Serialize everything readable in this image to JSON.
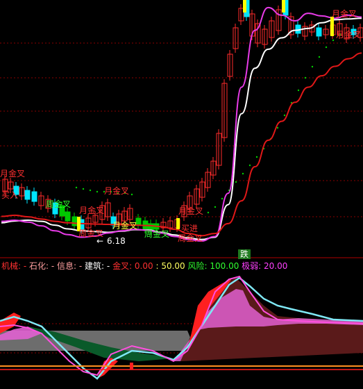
{
  "colors": {
    "bg": "#000000",
    "up": "#ff2b2b",
    "down": "#00e5ff",
    "ma_white": "#ffffff",
    "ma_magenta": "#e83be8",
    "ma_red": "#e01818",
    "dots": "#00d000",
    "signal_yellow": "#ffff00",
    "green_box": "#00c800",
    "label_red": "#ff3030",
    "label_yellow": "#ffff40",
    "label_green": "#30ff30",
    "grid": "#8b0000",
    "osc_red": "#ff2020",
    "osc_cyan": "#7fe8f5",
    "osc_magenta": "#ff4fe0",
    "osc_pink": "#e060d0",
    "osc_gray": "#808080",
    "osc_darkgreen": "#0a5a2a",
    "osc_brown": "#5a1a1a",
    "osc_orange": "#ff9020"
  },
  "main_labels": [
    {
      "text": "月金叉",
      "color": "label_red"
    },
    {
      "text": "买入",
      "color": "label_red"
    },
    {
      "text": "月金叉",
      "color": "label_red"
    },
    {
      "text": "周金叉",
      "color": "label_green"
    },
    {
      "text": "月金叉",
      "color": "label_red"
    },
    {
      "text": "月金叉",
      "color": "label_yellow"
    },
    {
      "text": "周金叉",
      "color": "label_green"
    },
    {
      "text": "周金叉",
      "color": "label_red"
    },
    {
      "text": "月金叉",
      "color": "label_red"
    },
    {
      "text": "买进",
      "color": "label_red"
    },
    {
      "text": "周金叉",
      "color": "label_red"
    },
    {
      "text": "月金叉",
      "color": "label_red"
    },
    {
      "text": "月金叉",
      "color": "label_red"
    }
  ],
  "low_marker": "6.18",
  "low_arrow": "←",
  "sell_tag": "跌",
  "indicator_legend": [
    {
      "text": "机械: ",
      "color": "#ff3030"
    },
    {
      "text": "- ",
      "color": "#ff3030"
    },
    {
      "text": "石化: ",
      "color": "#ffa0a0"
    },
    {
      "text": "- ",
      "color": "#ffa0a0"
    },
    {
      "text": "信息: ",
      "color": "#ffa0a0"
    },
    {
      "text": "- ",
      "color": "#ffa0a0"
    },
    {
      "text": "建筑: ",
      "color": "#ffffff"
    },
    {
      "text": "- ",
      "color": "#ffffff"
    },
    {
      "text": "金叉: 0.00",
      "color": "#ff3030"
    },
    {
      "text": "    : 50.00",
      "color": "#ffff60"
    },
    {
      "text": " 风险: 100.00",
      "color": "#30ff30"
    },
    {
      "text": " 极弱: 20.00",
      "color": "#ff40ff"
    }
  ],
  "chart_data": [
    {
      "type": "candlestick",
      "title": "",
      "ylim": [
        5.8,
        12.6
      ],
      "series": [
        {
          "name": "MA white",
          "type": "line",
          "values": [
            6.72,
            6.77,
            6.79,
            6.76,
            6.66,
            6.56,
            6.51,
            6.49,
            6.47,
            6.5,
            6.54,
            6.53,
            6.47,
            6.4,
            6.32,
            6.28,
            6.34,
            7.2,
            9.6,
            10.8,
            11.3,
            11.6,
            11.8,
            11.85,
            12.0,
            12.08,
            12.1,
            12.12
          ]
        },
        {
          "name": "MA magenta",
          "type": "line",
          "values": [
            6.76,
            6.79,
            6.74,
            6.64,
            6.51,
            6.41,
            6.34,
            6.37,
            6.45,
            6.51,
            6.55,
            6.52,
            6.45,
            6.36,
            6.28,
            6.24,
            6.36,
            7.5,
            10.3,
            11.8,
            12.4,
            12.2,
            12.05,
            12.25,
            12.18,
            12.12,
            12.2,
            12.15
          ]
        },
        {
          "name": "MA red",
          "type": "line",
          "values": [
            6.89,
            6.92,
            6.88,
            6.82,
            6.76,
            6.72,
            6.7,
            6.69,
            6.68,
            6.67,
            6.66,
            6.65,
            6.62,
            6.55,
            6.44,
            6.38,
            6.44,
            6.7,
            7.3,
            8.2,
            8.9,
            9.4,
            9.9,
            10.3,
            10.6,
            10.85,
            11.05,
            11.2
          ]
        }
      ]
    },
    {
      "type": "area",
      "title": "",
      "ylim": [
        -18,
        115
      ],
      "series": [
        {
          "name": "机械",
          "values": []
        },
        {
          "name": "石化",
          "values": []
        },
        {
          "name": "信息",
          "values": []
        },
        {
          "name": "建筑",
          "values": []
        },
        {
          "name": "金叉",
          "values": [
            0
          ]
        },
        {
          "name": "",
          "values": [
            50
          ]
        },
        {
          "name": "风险",
          "values": [
            100
          ]
        },
        {
          "name": "极弱",
          "values": [
            20
          ]
        }
      ]
    }
  ]
}
